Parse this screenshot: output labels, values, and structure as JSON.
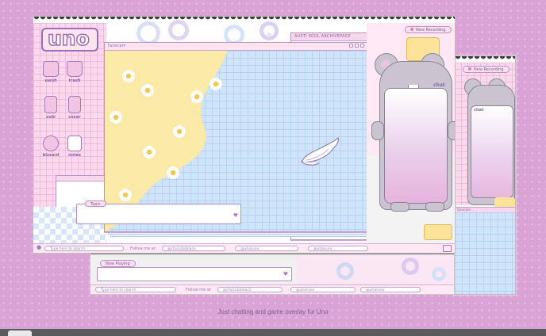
{
  "caption": "Just chatting and game overlay for Uno",
  "brand": {
    "logo_text": "uno"
  },
  "main_window": {
    "icons": [
      {
        "label": "uwuh"
      },
      {
        "label": "trash"
      },
      {
        "label": "oshi"
      },
      {
        "label": "cover"
      },
      {
        "label": "bizzard"
      },
      {
        "label": "notes"
      }
    ],
    "recording_pill": "New Recording",
    "cam_window_title": "facecam",
    "notes_window_title": "AUSTI SOUL ARCHIVEPAGE",
    "chat_label": "chat",
    "topic_label": "Topic",
    "taskbar": {
      "search_placeholder": "Type here to search",
      "follow_label": "Follow me at",
      "handle_1": "@chocolatelace",
      "handle_2": "@uharuno",
      "handle_3": "@uharuno"
    }
  },
  "bottom_window": {
    "playing_label": "New Playing",
    "taskbar": {
      "search_placeholder": "Type here to search",
      "follow_label": "Follow me at",
      "handle_1": "@chocolatelace",
      "handle_2": "@uharuno",
      "handle_3": "@uharuno"
    }
  },
  "right_window": {
    "recording_pill": "New Recording",
    "chat_label": "chat",
    "cam_title": "facecam"
  },
  "colors": {
    "background": "#d9a3d6",
    "accent_pink": "#f7d7ec",
    "grid_blue": "#cfe4fb",
    "yellow": "#fbe9a8",
    "mouse_grey": "#c9c4cf",
    "frame_dark": "#3d3d3d"
  }
}
